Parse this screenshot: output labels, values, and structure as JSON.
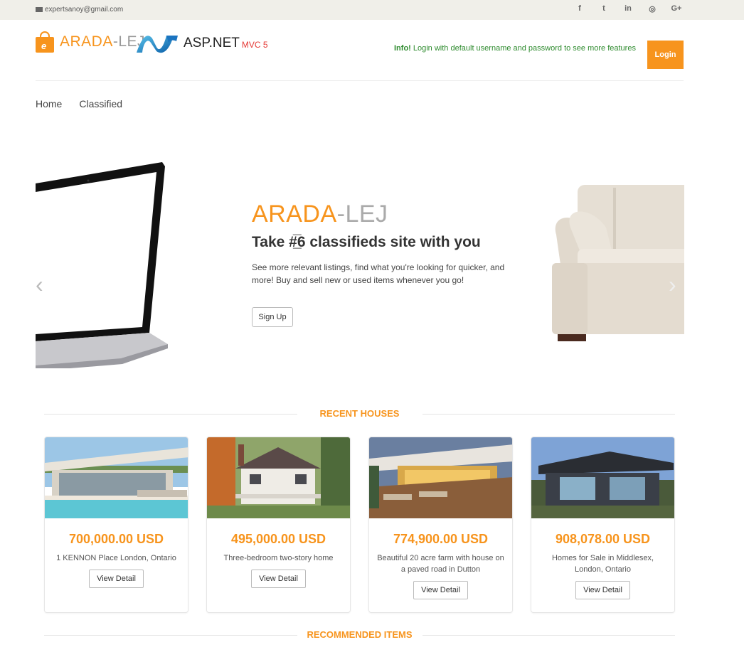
{
  "topbar": {
    "email": "expertsanoy@gmail.com",
    "social": [
      "f",
      "t",
      "in",
      "◎",
      "G+"
    ],
    "social_icons": [
      "facebook-icon",
      "twitter-icon",
      "linkedin-icon",
      "dribbble-icon",
      "google-plus-icon"
    ]
  },
  "header": {
    "brand_a": "ARADA",
    "brand_b": "-LEJ",
    "bag_letter": "e",
    "aspnet": "ASP.NET",
    "mvc": "MVC 5",
    "info_strong": "Info!",
    "info_text": " Login with default username and password to see more features",
    "login": "Login"
  },
  "nav": [
    "Home",
    "Classified"
  ],
  "hero": {
    "title_a": "ARADA",
    "title_b": "-LEJ",
    "subtitle": "Take #̲̅6 classifieds site with you",
    "desc": "See more relevant listings, find what you're looking for quicker, and more! Buy and sell new or used items whenever you go!",
    "signup": "Sign Up",
    "prev": "‹",
    "next": "›"
  },
  "sections": {
    "recent": "RECENT HOUSES",
    "recommended": "RECOMMENDED ITEMS"
  },
  "houses": [
    {
      "price": "700,000.00 USD",
      "desc": "1 KENNON Place London, Ontario",
      "button": "View Detail"
    },
    {
      "price": "495,000.00 USD",
      "desc": "Three-bedroom two-story home",
      "button": "View Detail"
    },
    {
      "price": "774,900.00 USD",
      "desc": "Beautiful 20 acre farm with house on a paved road in Dutton",
      "button": "View Detail"
    },
    {
      "price": "908,078.00 USD",
      "desc": "Homes for Sale in Middlesex, London, Ontario",
      "button": "View Detail"
    }
  ],
  "colors": {
    "accent": "#f7941d",
    "info_green": "#2e8b2e",
    "topbar_bg": "#f0efe9"
  }
}
